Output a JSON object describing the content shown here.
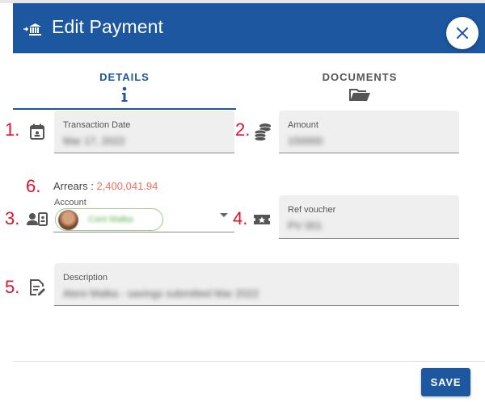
{
  "dialog": {
    "title": "Edit Payment",
    "header_icon": "bank-transfer-icon",
    "close_icon": "close-icon"
  },
  "tabs": [
    {
      "label": "DETAILS",
      "icon": "info-icon",
      "active": true
    },
    {
      "label": "DOCUMENTS",
      "icon": "folder-open-icon",
      "active": false
    }
  ],
  "markers": [
    "1.",
    "2.",
    "3.",
    "4.",
    "5.",
    "6."
  ],
  "fields": {
    "transaction_date": {
      "label": "Transaction Date",
      "value": "Mar 17, 2022",
      "icon": "calendar-icon"
    },
    "amount": {
      "label": "Amount",
      "value": "150000",
      "icon": "coins-icon"
    },
    "account": {
      "label": "Account",
      "value": "Cont Malka",
      "icon": "contact-card-icon"
    },
    "ref_voucher": {
      "label": "Ref voucher",
      "value": "PV 001",
      "icon": "ticket-icon"
    },
    "description": {
      "label": "Description",
      "value": "Ateni Malka - savings submitted Mar 2022",
      "icon": "edit-note-icon"
    }
  },
  "arrears": {
    "label": "Arrears :",
    "amount": "2,400,041.94"
  },
  "actions": {
    "save_label": "SAVE"
  },
  "colors": {
    "primary": "#1d57a0",
    "marker": "#e3122a",
    "arrears_amount": "#ee6f5f",
    "chip_border": "#9ccc8e"
  }
}
